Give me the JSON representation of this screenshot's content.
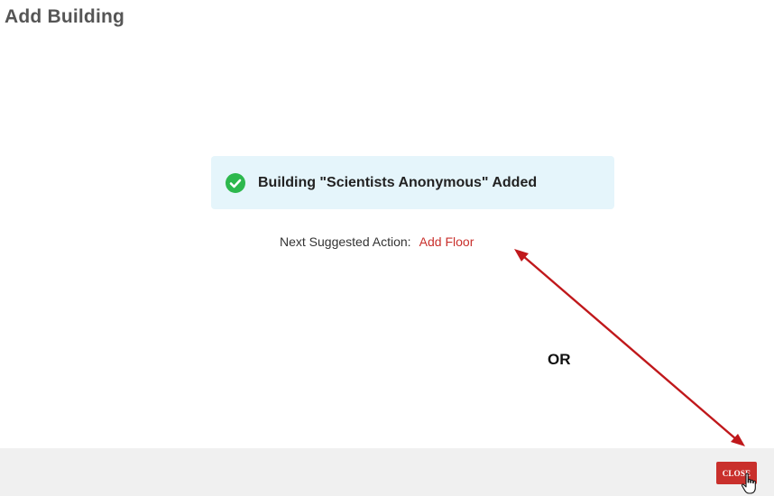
{
  "dialog": {
    "title": "Add Building"
  },
  "banner": {
    "icon": "check-circle-icon",
    "message": "Building \"Scientists Anonymous\" Added"
  },
  "next_action": {
    "label": "Next Suggested Action:",
    "link_label": "Add Floor"
  },
  "annotation": {
    "or_text": "OR"
  },
  "footer": {
    "close_label": "CLOSE"
  },
  "colors": {
    "accent": "#c9302c",
    "success": "#2db84d",
    "banner_bg": "#e5f5fb",
    "footer_bg": "#f0f0f0",
    "arrow": "#c0181b"
  }
}
